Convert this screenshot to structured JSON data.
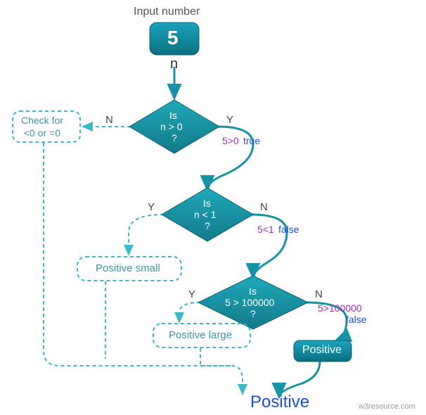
{
  "title": "Input number",
  "input": {
    "value": "5",
    "var": "n"
  },
  "decisions": {
    "d1": {
      "l1": "Is",
      "l2": "n > 0",
      "l3": "?"
    },
    "d2": {
      "l1": "Is",
      "l2": "n < 1",
      "l3": "?"
    },
    "d3": {
      "l1": "Is",
      "l2": "5 > 100000",
      "l3": "?"
    }
  },
  "branches": {
    "Y": "Y",
    "N": "N"
  },
  "annot": {
    "a1": {
      "expr": "5>0",
      "res": "true"
    },
    "a2": {
      "expr": "5<1",
      "res": "false"
    },
    "a3": {
      "expr": "5>100000",
      "res": "false"
    }
  },
  "boxes": {
    "check": "Check for\n<0 or =0",
    "small": "Positive small",
    "large": "Positive large",
    "positive": "Positive"
  },
  "output": "Positive",
  "footer": "w3resource.com",
  "chart_data": {
    "type": "flowchart",
    "input_value": 5,
    "nodes": [
      {
        "id": "in",
        "kind": "input",
        "label": "n = 5"
      },
      {
        "id": "d1",
        "kind": "decision",
        "condition": "n > 0",
        "eval": "5>0",
        "result": true
      },
      {
        "id": "d2",
        "kind": "decision",
        "condition": "n < 1",
        "eval": "5<1",
        "result": false
      },
      {
        "id": "d3",
        "kind": "decision",
        "condition": "5 > 100000",
        "eval": "5>100000",
        "result": false
      },
      {
        "id": "check",
        "kind": "process-ghost",
        "label": "Check for <0 or =0"
      },
      {
        "id": "small",
        "kind": "process-ghost",
        "label": "Positive small"
      },
      {
        "id": "large",
        "kind": "process-ghost",
        "label": "Positive large"
      },
      {
        "id": "pos",
        "kind": "process",
        "label": "Positive"
      },
      {
        "id": "out",
        "kind": "output",
        "label": "Positive"
      }
    ],
    "edges": [
      {
        "from": "in",
        "to": "d1"
      },
      {
        "from": "d1",
        "to": "check",
        "label": "N",
        "ghost": true
      },
      {
        "from": "d1",
        "to": "d2",
        "label": "Y"
      },
      {
        "from": "d2",
        "to": "small",
        "label": "Y",
        "ghost": true
      },
      {
        "from": "d2",
        "to": "d3",
        "label": "N"
      },
      {
        "from": "d3",
        "to": "large",
        "label": "Y",
        "ghost": true
      },
      {
        "from": "d3",
        "to": "pos",
        "label": "N"
      },
      {
        "from": "pos",
        "to": "out"
      },
      {
        "from": "small",
        "to": "out",
        "ghost": true
      },
      {
        "from": "large",
        "to": "out",
        "ghost": true
      },
      {
        "from": "check",
        "to": "out",
        "ghost": true
      }
    ],
    "traversed_path": [
      "in",
      "d1",
      "d2",
      "d3",
      "pos",
      "out"
    ],
    "final_output": "Positive"
  }
}
